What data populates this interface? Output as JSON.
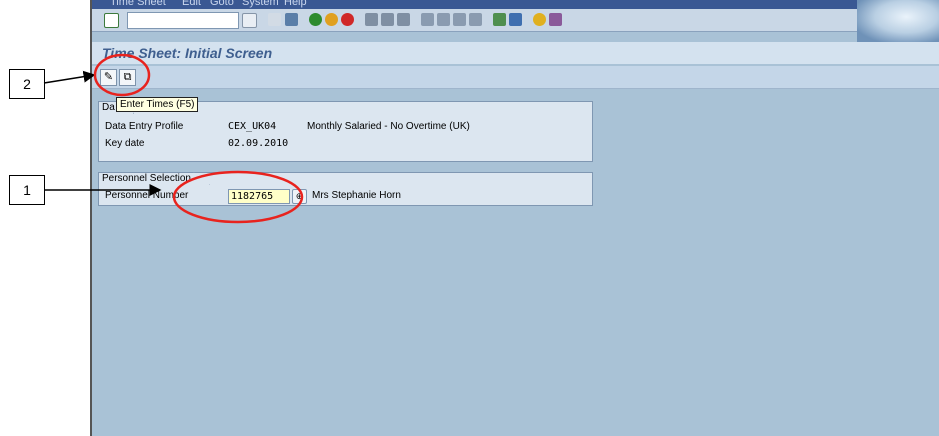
{
  "menu": [
    "Time Sheet",
    "Edit",
    "Goto",
    "System",
    "Help"
  ],
  "screen_title": "Time Sheet: Initial Screen",
  "toolbar": {
    "tooltip": "Enter Times  (F5)"
  },
  "data_group": {
    "title_fragment": "Da",
    "profile_label": "Data Entry Profile",
    "profile_value": "CEX_UK04",
    "profile_desc": "Monthly Salaried - No Overtime (UK)",
    "keydate_label": "Key date",
    "keydate_value": "02.09.2010"
  },
  "personnel_group": {
    "title": "Personnel Selection",
    "number_label": "Personnel Number",
    "number_value": "1182765",
    "name": "Mrs Stephanie Horn"
  },
  "callouts": {
    "one": "1",
    "two": "2"
  },
  "colors": {
    "background": "#a9c2d6",
    "annotation_red": "#e8231e",
    "title": "#3f5f8f"
  }
}
